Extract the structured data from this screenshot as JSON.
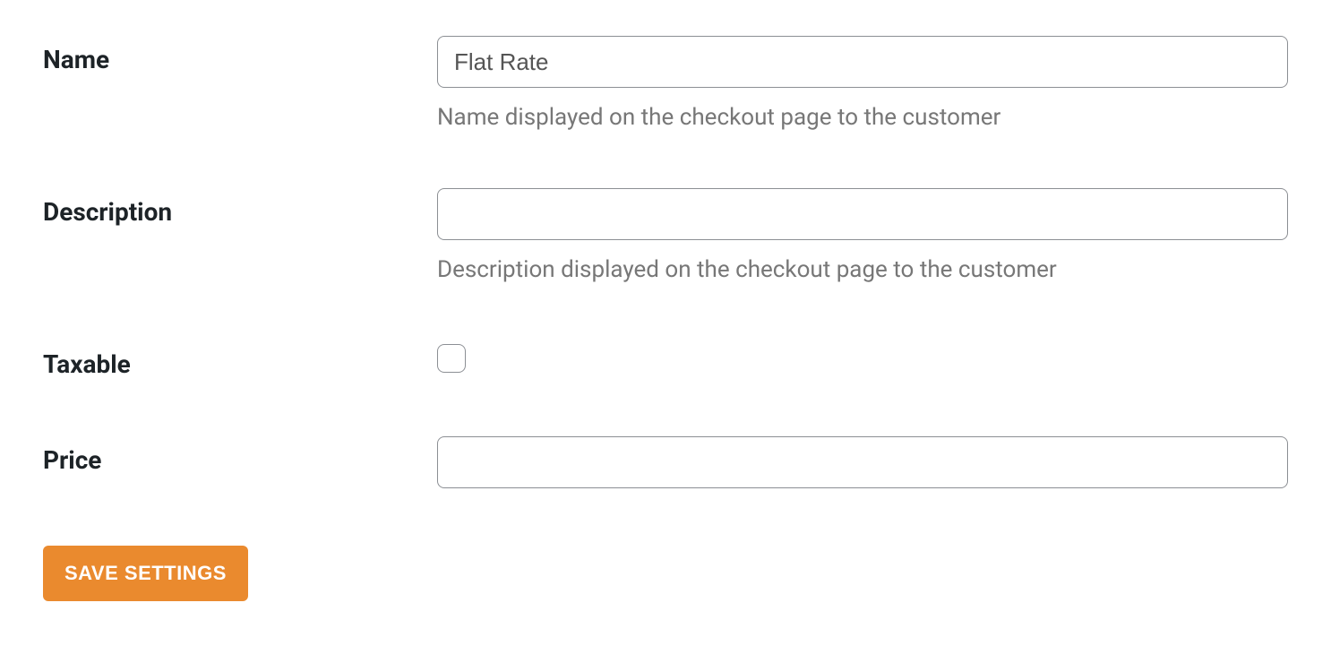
{
  "form": {
    "name": {
      "label": "Name",
      "value": "Flat Rate",
      "helper": "Name displayed on the checkout page to the customer"
    },
    "description": {
      "label": "Description",
      "value": "",
      "helper": "Description displayed on the checkout page to the customer"
    },
    "taxable": {
      "label": "Taxable",
      "checked": false
    },
    "price": {
      "label": "Price",
      "value": ""
    }
  },
  "actions": {
    "save_label": "SAVE SETTINGS"
  }
}
